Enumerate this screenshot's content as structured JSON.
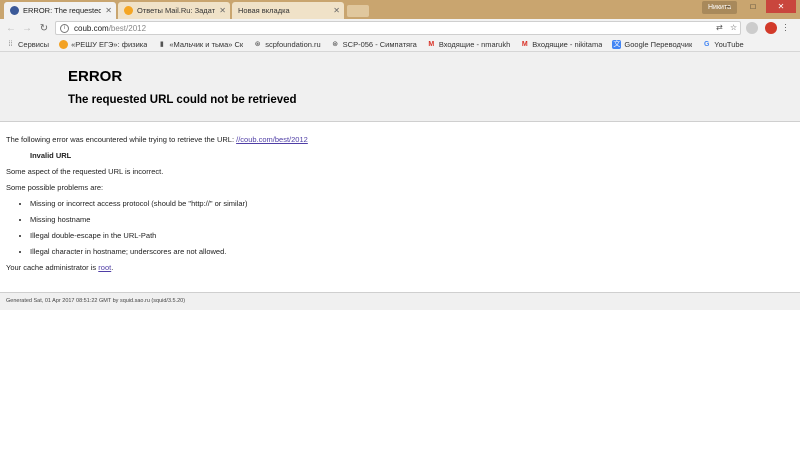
{
  "tabs": [
    {
      "label": "ERROR: The requested U",
      "favicon": "facebook-icon",
      "color": "#3b5998"
    },
    {
      "label": "Ответы Mail.Ru: Задать",
      "favicon": "mailru-answers-icon",
      "color": "#f5a623"
    },
    {
      "label": "Новая вкладка",
      "favicon": "",
      "color": ""
    }
  ],
  "window": {
    "user": "Никита",
    "minimize": "–",
    "maximize": "□",
    "close": "✕"
  },
  "toolbar": {
    "url_host": "coub.com",
    "url_path": "/best/2012"
  },
  "bookmarks": [
    {
      "label": "Сервисы",
      "icon": "apps-grid-icon"
    },
    {
      "label": "«РЕШУ ЕГЭ»: физика",
      "icon": "reshu-ege-icon"
    },
    {
      "label": "«Мальчик и тьма» Ск",
      "icon": "book-icon"
    },
    {
      "label": "scpfoundation.ru",
      "icon": "scp-icon"
    },
    {
      "label": "SCP-056 - Симпатяга",
      "icon": "scp-icon"
    },
    {
      "label": "Входящие - nmarukh",
      "icon": "gmail-icon"
    },
    {
      "label": "Входящие - nikitama",
      "icon": "gmail-icon"
    },
    {
      "label": "Google Переводчик",
      "icon": "translate-icon"
    },
    {
      "label": "YouTube",
      "icon": "google-icon"
    }
  ],
  "page": {
    "title": "ERROR",
    "subtitle": "The requested URL could not be retrieved",
    "intro": "The following error was encountered while trying to retrieve the URL: ",
    "url_link": "//coub.com/best/2012",
    "error_name": "Invalid URL",
    "aspect": "Some aspect of the requested URL is incorrect.",
    "problems_heading": "Some possible problems are:",
    "problems": [
      "Missing or incorrect access protocol (should be \"http://\" or similar)",
      "Missing hostname",
      "Illegal double-escape in the URL-Path",
      "Illegal character in hostname; underscores are not allowed."
    ],
    "admin_prefix": "Your cache administrator is ",
    "admin_link": "root",
    "admin_suffix": ".",
    "footer": "Generated Sat, 01 Apr 2017 08:51:22 GMT by squid.sao.ru (squid/3.5.20)"
  }
}
